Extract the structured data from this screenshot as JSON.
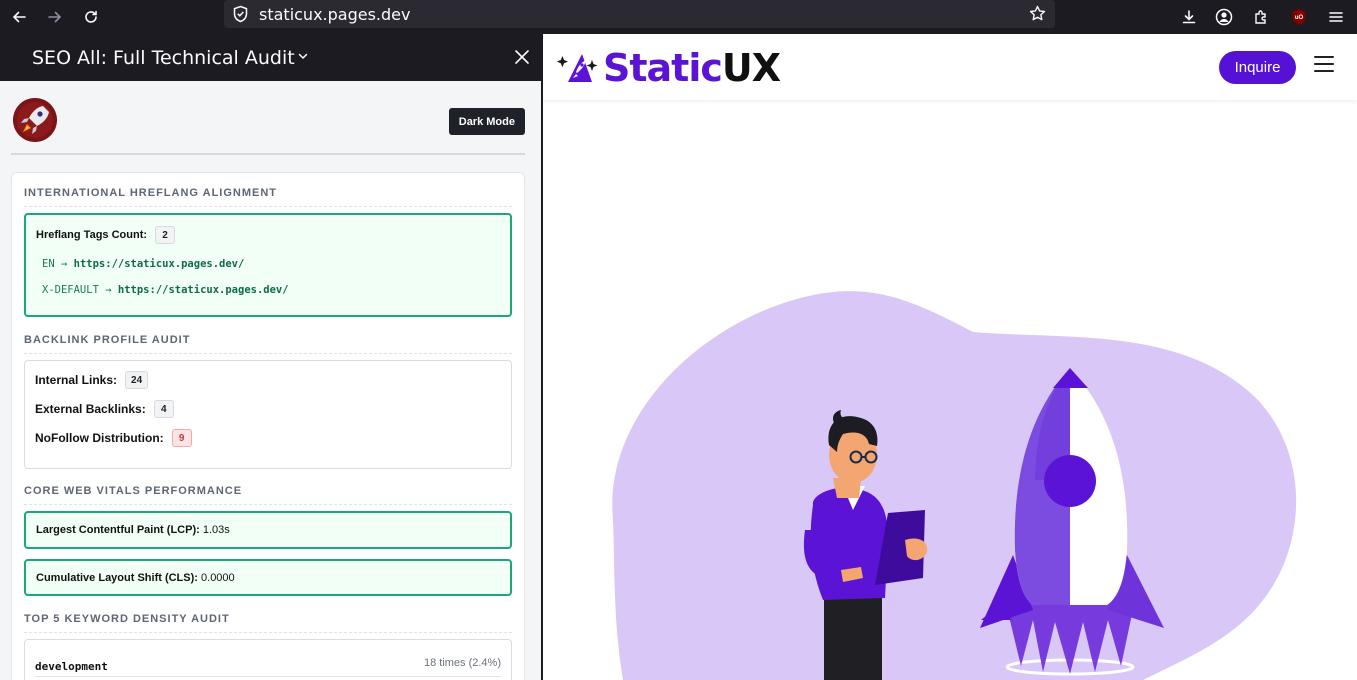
{
  "browser": {
    "url": "staticux.pages.dev",
    "icons": [
      "back-arrow-icon",
      "forward-arrow-icon",
      "reload-icon",
      "shield-icon",
      "star-icon",
      "download-icon",
      "account-icon",
      "extensions-icon",
      "ublock-icon",
      "menu-icon"
    ]
  },
  "sidebar": {
    "title": "SEO All: Full Technical Audit",
    "dark_mode_label": "Dark Mode",
    "hreflang": {
      "heading": "INTERNATIONAL HREFLANG ALIGNMENT",
      "count_label": "Hreflang Tags Count:",
      "count_value": "2",
      "entries": [
        {
          "lang": "EN",
          "arrow": "→",
          "url": "https://staticux.pages.dev/"
        },
        {
          "lang": "X-DEFAULT",
          "arrow": "→",
          "url": "https://staticux.pages.dev/"
        }
      ]
    },
    "backlinks": {
      "heading": "BACKLINK PROFILE AUDIT",
      "internal_label": "Internal Links:",
      "internal_value": "24",
      "external_label": "External Backlinks:",
      "external_value": "4",
      "nofollow_label": "NoFollow Distribution:",
      "nofollow_value": "9"
    },
    "vitals": {
      "heading": "CORE WEB VITALS PERFORMANCE",
      "lcp_label": "Largest Contentful Paint (LCP):",
      "lcp_value": "1.03s",
      "cls_label": "Cumulative Layout Shift (CLS):",
      "cls_value": "0.0000"
    },
    "keywords": {
      "heading": "TOP 5 KEYWORD DENSITY AUDIT",
      "rows": [
        {
          "word": "development",
          "count": "18 times (2.4%)"
        }
      ]
    }
  },
  "site": {
    "brand_part1": "Static",
    "brand_part2": "UX",
    "inquire_label": "Inquire",
    "colors": {
      "brand": "#5512d6",
      "blob": "#d9c8f7"
    }
  }
}
